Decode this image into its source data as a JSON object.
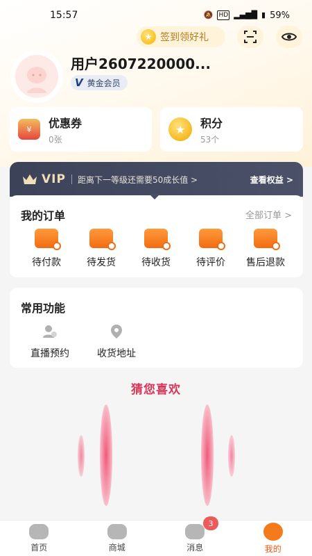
{
  "status": {
    "time": "15:57",
    "battery": "59%"
  },
  "header": {
    "signin_label": "签到领好礼"
  },
  "user": {
    "name": "用户2607220000...",
    "level": "黄金会员",
    "level_mark": "V"
  },
  "coupons": {
    "title": "优惠券",
    "count": "0张",
    "icon_glyph": "¥"
  },
  "points": {
    "title": "积分",
    "count": "53个",
    "icon_glyph": "★"
  },
  "vip": {
    "label": "VIP",
    "desc": "距离下一等级还需要50成长值 >",
    "link": "查看权益 >"
  },
  "orders": {
    "title": "我的订单",
    "all_link": "全部订单 >",
    "items": [
      {
        "label": "待付款",
        "icon": "wallet-icon"
      },
      {
        "label": "待发货",
        "icon": "box-icon"
      },
      {
        "label": "待收货",
        "icon": "truck-icon"
      },
      {
        "label": "待评价",
        "icon": "review-icon"
      },
      {
        "label": "售后退款",
        "icon": "refund-icon"
      }
    ]
  },
  "functions": {
    "title": "常用功能",
    "items": [
      {
        "label": "直播预约",
        "icon": "live-reservation-icon"
      },
      {
        "label": "收货地址",
        "icon": "location-pin-icon"
      }
    ]
  },
  "recommend": {
    "title": "猜您喜欢"
  },
  "tabbar": {
    "items": [
      {
        "label": "首页",
        "icon": "home-icon",
        "active": false
      },
      {
        "label": "商城",
        "icon": "shop-icon",
        "active": false
      },
      {
        "label": "消息",
        "icon": "message-icon",
        "active": false,
        "badge": "3"
      },
      {
        "label": "我的",
        "icon": "profile-icon",
        "active": true
      }
    ]
  },
  "colors": {
    "accent": "#f26b12",
    "vip_bar": "#444a61",
    "recommend_title": "#d8375a",
    "badge": "#ee5a5a"
  }
}
